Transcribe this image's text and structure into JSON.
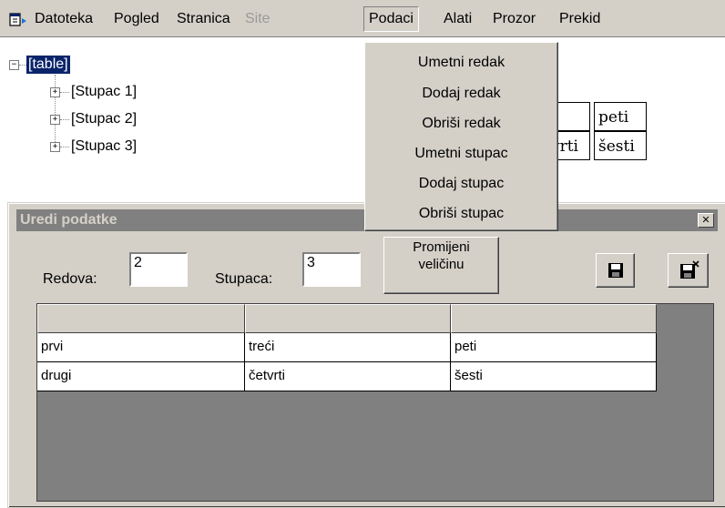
{
  "menubar": {
    "items": [
      "Datoteka",
      "Pogled",
      "Stranica",
      "Site",
      "Podaci",
      "Alati",
      "Prozor",
      "Prekid"
    ],
    "disabled_item": "Site",
    "open_item": "Podaci"
  },
  "dropdown": {
    "items": [
      "Umetni redak",
      "Dodaj redak",
      "Obriši redak",
      "Umetni stupac",
      "Dodaj stupac",
      "Obriši stupac"
    ]
  },
  "tree": {
    "root_label": "[table]",
    "children": [
      "[Stupac 1]",
      "[Stupac 2]",
      "[Stupac 3]"
    ]
  },
  "preview": {
    "cells": [
      "i",
      "peti",
      "vrti",
      "šesti"
    ]
  },
  "dialog": {
    "title": "Uredi podatke",
    "rows_label": "Redova:",
    "rows_value": "2",
    "cols_label": "Stupaca:",
    "cols_value": "3",
    "resize_line1": "Promijeni",
    "resize_line2": "veličinu"
  },
  "grid": {
    "headers": [
      "",
      "",
      ""
    ],
    "rows": [
      [
        "prvi",
        "treći",
        "peti"
      ],
      [
        "drugi",
        "četvrti",
        "šesti"
      ]
    ]
  },
  "colors": {
    "face": "#d4d0c8",
    "selection": "#0a246a",
    "titlebar_inactive": "#808080"
  },
  "icons": [
    "app-icon",
    "tree-expand-icon",
    "tree-collapse-icon",
    "save-icon",
    "save-close-icon",
    "close-icon"
  ]
}
